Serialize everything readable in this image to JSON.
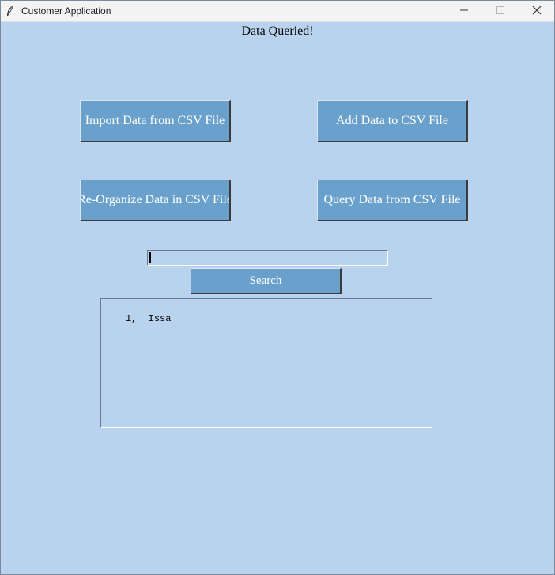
{
  "window": {
    "title": "Customer Application",
    "icon": "feather-icon",
    "controls": {
      "minimize": "minimize-icon",
      "maximize": "maximize-icon",
      "close": "close-icon"
    }
  },
  "status": {
    "message": "Data Queried!"
  },
  "buttons": {
    "import": "Import Data from CSV File",
    "add": "Add Data to CSV File",
    "reorganize": "Re-Organize Data in CSV File",
    "query": "Query Data from CSV File",
    "search": "Search"
  },
  "search": {
    "value": "",
    "placeholder": ""
  },
  "results": {
    "text": "1,  Issa"
  },
  "colors": {
    "background": "#b9d3ee",
    "button": "#6aa1cc",
    "button_text": "#ffffff",
    "titlebar": "#f3f3f3"
  }
}
